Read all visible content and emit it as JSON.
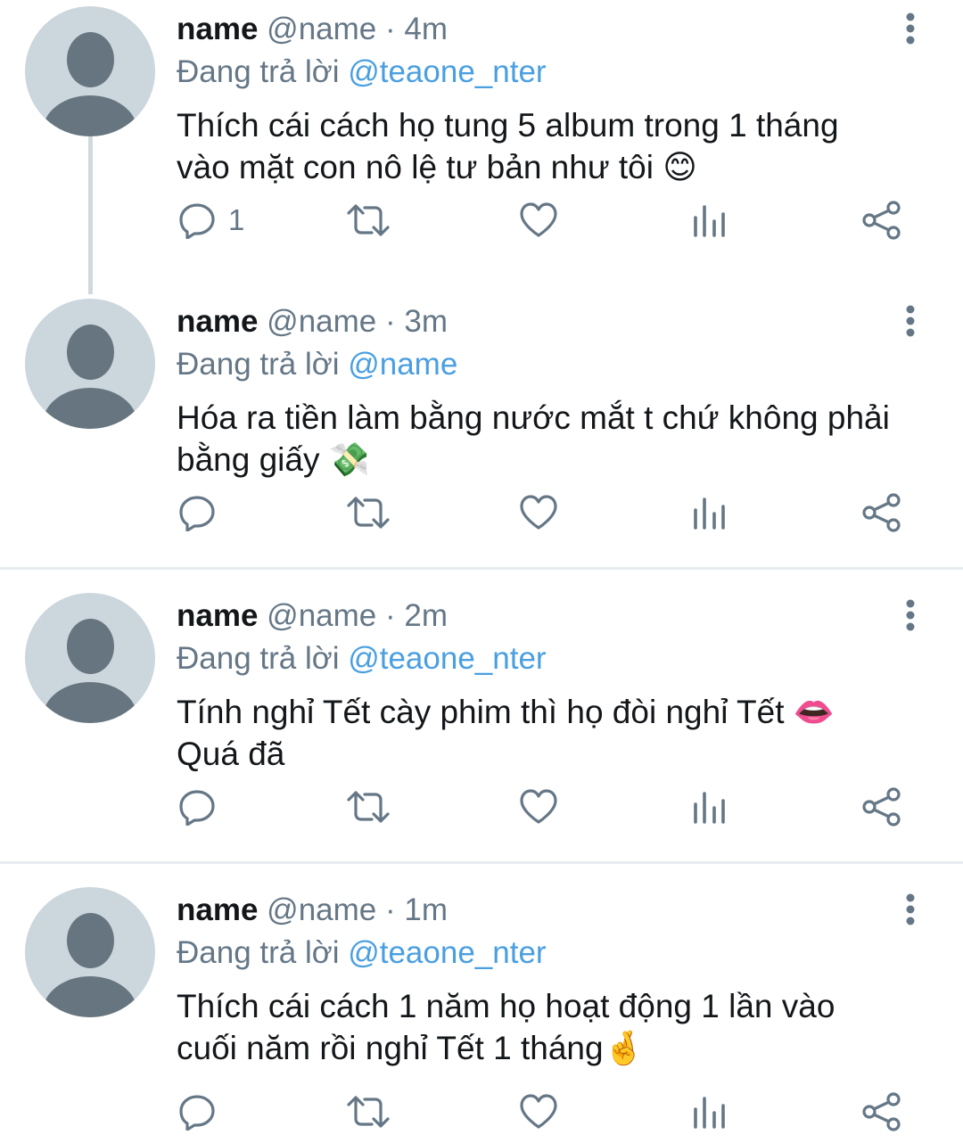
{
  "colors": {
    "mention": "#4a9fe0",
    "secondary_text": "#657786",
    "primary_text": "#14171a",
    "avatar_bg": "#ccd6dd",
    "avatar_fg": "#66757f",
    "divider": "#e6ecf0"
  },
  "tweets": [
    {
      "display_name": "name",
      "handle": "@name",
      "separator": "·",
      "time": "4m",
      "reply_prefix": "Đang trả lời",
      "reply_to": "@teaone_nter",
      "text_lines": [
        "Thích cái cách họ tung 5 album trong 1 tháng",
        "vào mặt con nô lệ tư bản như tôi"
      ],
      "emoji": "😊",
      "emoji_name": "smiling-face-icon",
      "reply_count": "1"
    },
    {
      "display_name": "name",
      "handle": "@name",
      "separator": "·",
      "time": "3m",
      "reply_prefix": "Đang trả lời",
      "reply_to": "@name",
      "text_lines": [
        "Hóa ra tiền làm bằng nước mắt t chứ không phải",
        "bằng giấy"
      ],
      "emoji": "💸",
      "emoji_name": "money-with-wings-icon",
      "reply_count": ""
    },
    {
      "display_name": "name",
      "handle": "@name",
      "separator": "·",
      "time": "2m",
      "reply_prefix": "Đang trả lời",
      "reply_to": "@teaone_nter",
      "text_lines": [
        "Tính nghỉ Tết cày phim thì họ đòi nghỉ Tết",
        "Quá đã"
      ],
      "emoji": "👄",
      "emoji_name": "mouth-icon",
      "reply_count": ""
    },
    {
      "display_name": "name",
      "handle": "@name",
      "separator": "·",
      "time": "1m",
      "reply_prefix": "Đang trả lời",
      "reply_to": "@teaone_nter",
      "text_lines": [
        "Thích cái cách 1 năm họ hoạt động 1 lần vào",
        "cuối năm rồi nghỉ Tết 1 tháng"
      ],
      "emoji": "🤞",
      "emoji_name": "crossed-fingers-icon",
      "reply_count": ""
    }
  ],
  "action_icons": [
    "reply-icon",
    "retweet-icon",
    "like-icon",
    "analytics-icon",
    "share-icon"
  ]
}
